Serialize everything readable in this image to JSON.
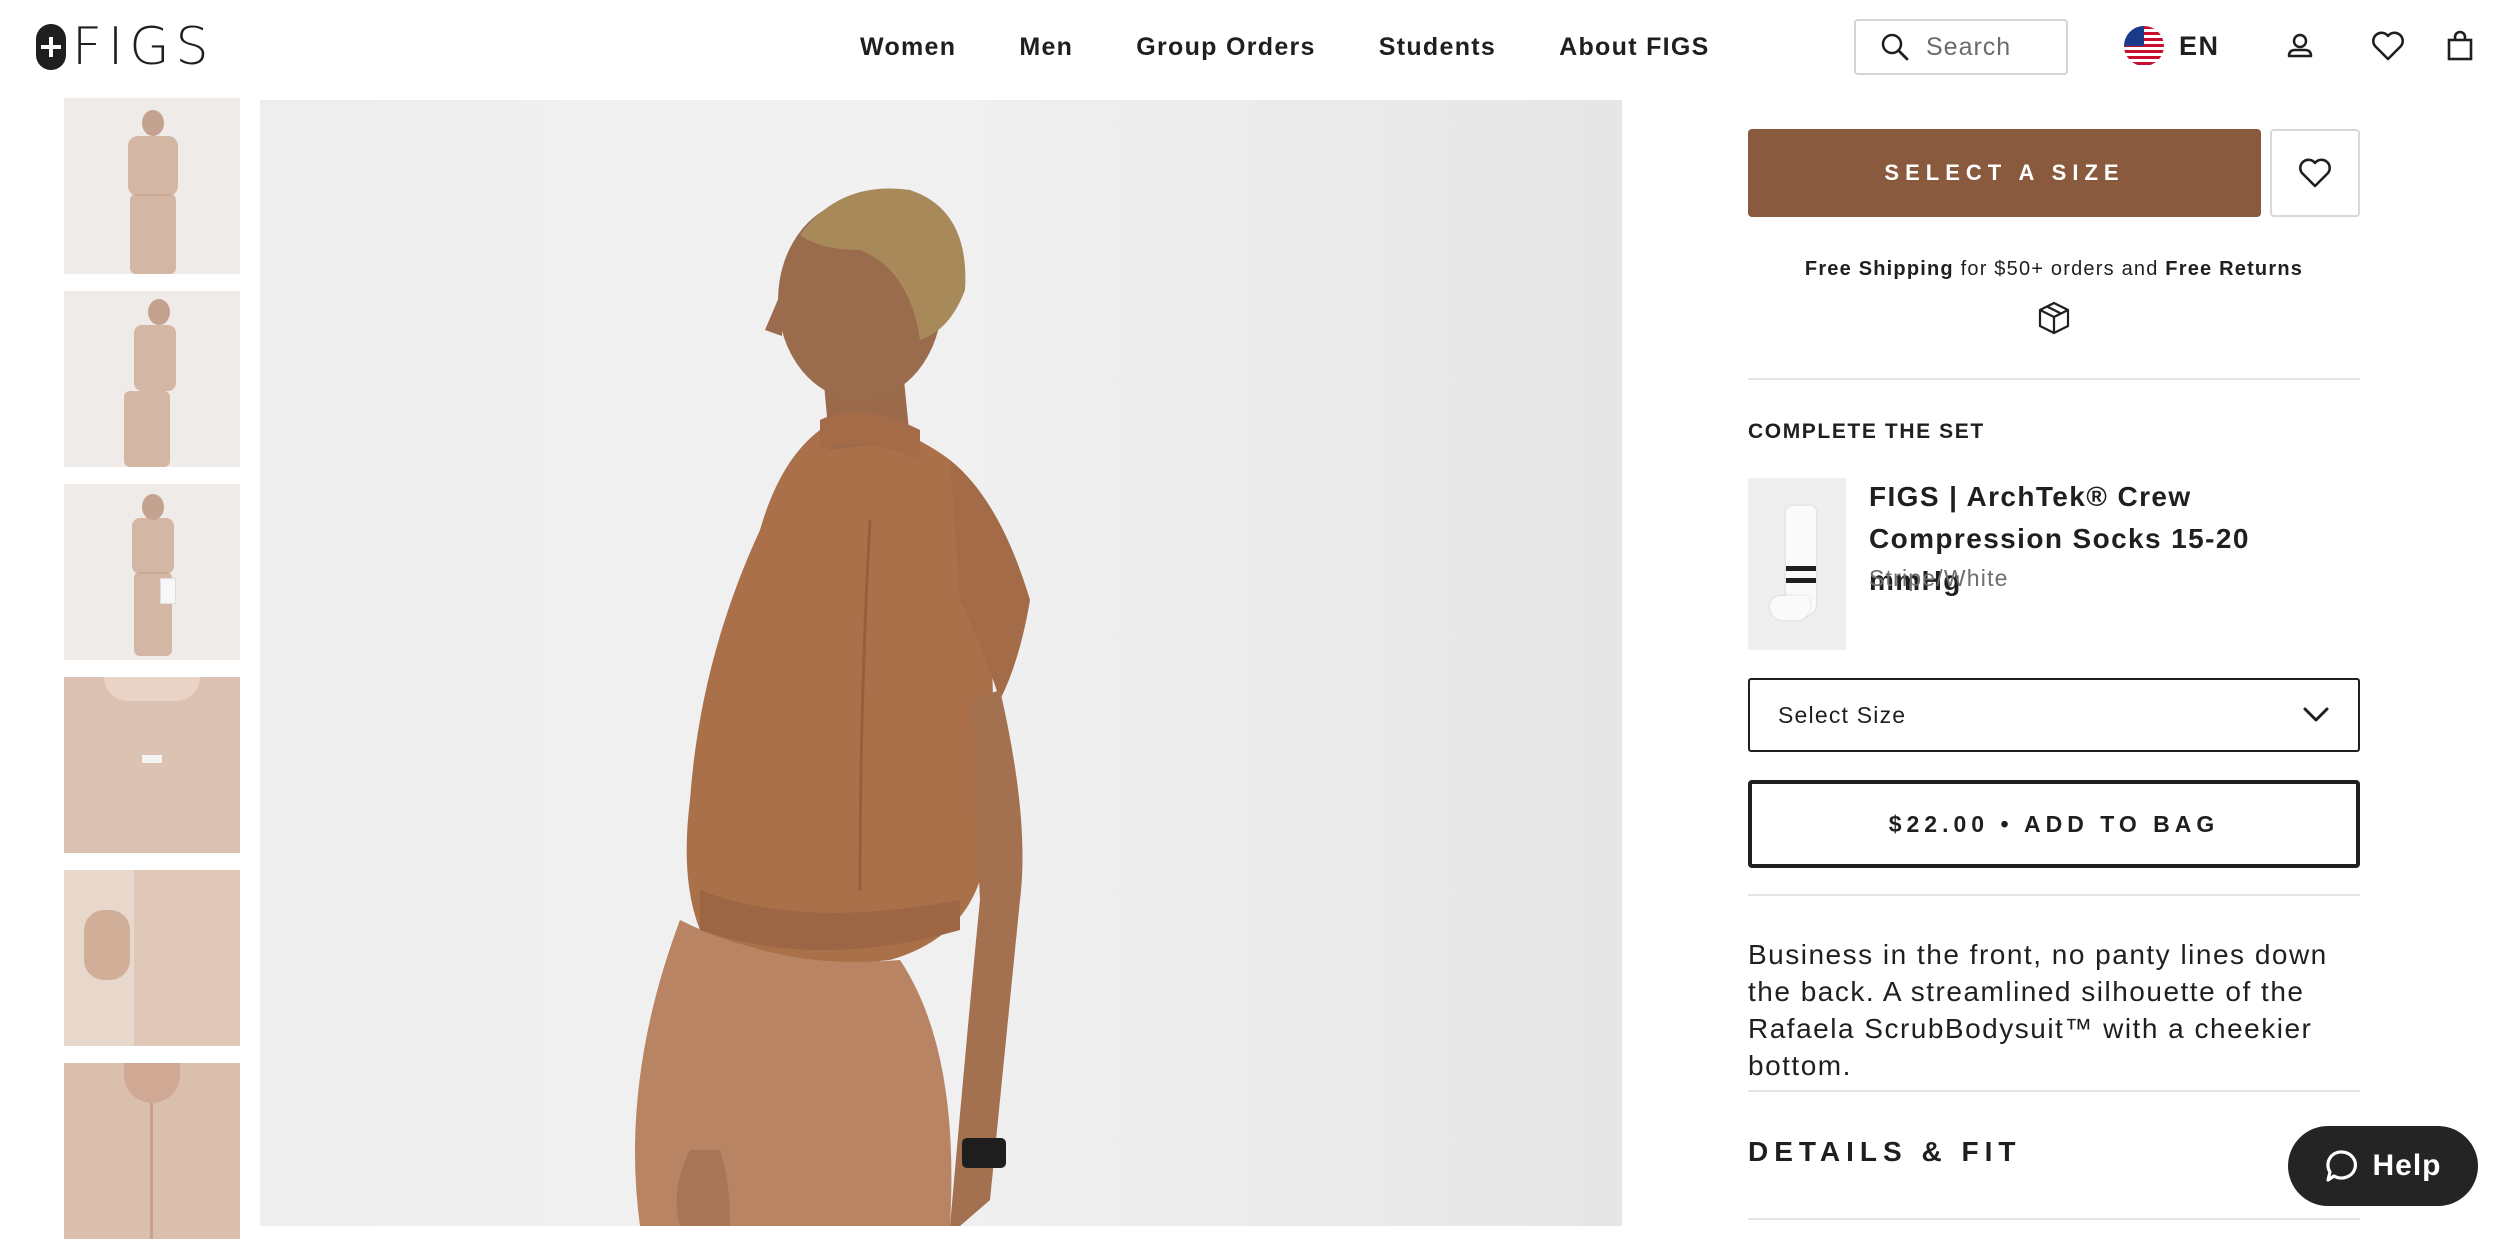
{
  "header": {
    "logo_text": "FIGS",
    "nav": [
      "Women",
      "Men",
      "Group Orders",
      "Students",
      "About FIGS"
    ],
    "search_placeholder": "Search",
    "language": "EN",
    "icons": [
      "search-icon",
      "us-flag-icon",
      "account-icon",
      "wishlist-icon",
      "bag-icon"
    ]
  },
  "gallery": {
    "thumbnail_count": 6
  },
  "product": {
    "select_size_label": "SELECT A SIZE",
    "shipping": {
      "free_shipping": "Free Shipping",
      "middle": " for $50+ orders and ",
      "free_returns": "Free Returns"
    },
    "complete_set": {
      "title": "COMPLETE THE SET",
      "item_name": "FIGS | ArchTek® Crew Compression Socks 15-20 mmHg",
      "item_color": "Stripe/White",
      "size_select": "Select Size",
      "add_to_bag": "$22.00 • ADD TO BAG"
    },
    "description": "Business in the front, no panty lines down the back. A streamlined silhouette of the Rafaela ScrubBodysuit™ with a cheekier bottom.",
    "details_title": "DETAILS & FIT"
  },
  "help": {
    "label": "Help"
  },
  "colors": {
    "accent_brown": "#8a5a3f",
    "text": "#1f1f1f",
    "help_bg": "#242424"
  }
}
